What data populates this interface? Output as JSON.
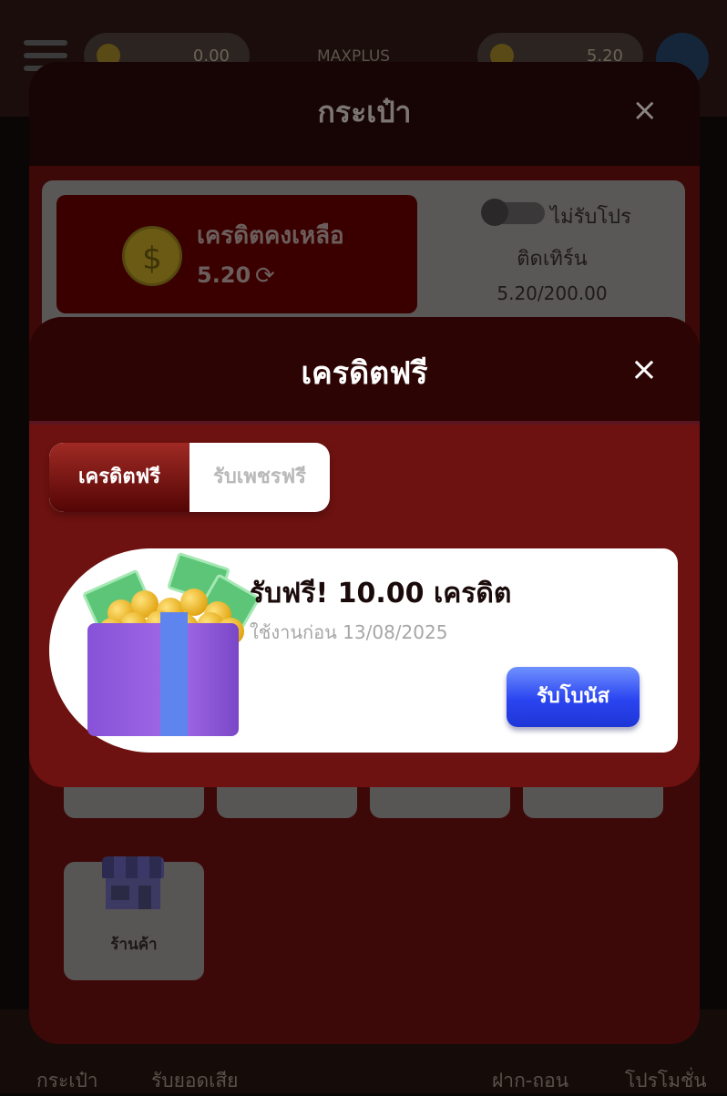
{
  "background": {
    "top_left_balance": "0.00",
    "brand": "MAXPLUS",
    "top_right_balance": "5.20",
    "bottom_nav": [
      "กระเป๋า",
      "รับยอดเสีย",
      "ฝาก-ถอน",
      "โปรโมชั่น"
    ]
  },
  "wallet": {
    "title": "กระเป๋า",
    "close_icon": "×",
    "balance_label": "เครดิตคงเหลือ",
    "balance_value": "5.20",
    "coin_symbol": "$",
    "refresh_icon": "⟳",
    "promo_toggle_label": "ไม่รับโปร",
    "turnover_label": "ติดเทิร์น",
    "turnover_value": "5.20/200.00",
    "shop_label": "ร้านค้า"
  },
  "free_credit": {
    "title": "เครดิตฟรี",
    "close_icon": "×",
    "tabs": [
      "เครดิตฟรี",
      "รับเพชรฟรี"
    ],
    "reward": {
      "title": "รับฟรี! 10.00 เครดิต",
      "expiry": "ใช้งานก่อน 13/08/2025",
      "claim_label": "รับโบนัส"
    }
  },
  "colors": {
    "modal_red": "#6d1210",
    "header_dark": "#2c0403",
    "claim_blue": "#2a44f0"
  }
}
